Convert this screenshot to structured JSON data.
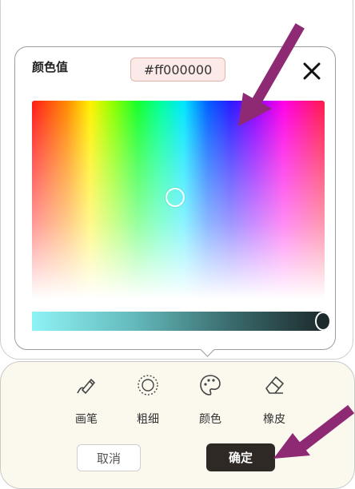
{
  "picker": {
    "label": "颜色值",
    "hex_value": "#ff000000",
    "close_icon": "close-icon"
  },
  "tools": [
    {
      "label": "画笔",
      "icon": "pen-icon"
    },
    {
      "label": "粗细",
      "icon": "thickness-icon"
    },
    {
      "label": "颜色",
      "icon": "palette-icon"
    },
    {
      "label": "橡皮",
      "icon": "eraser-icon"
    }
  ],
  "actions": {
    "cancel_label": "取消",
    "confirm_label": "确定"
  },
  "colors": {
    "annotation_arrow": "#8e2a74",
    "confirm_bg": "#2f2926",
    "hex_field_bg": "#fbeae8",
    "panel_bg": "#fbf8ee"
  }
}
